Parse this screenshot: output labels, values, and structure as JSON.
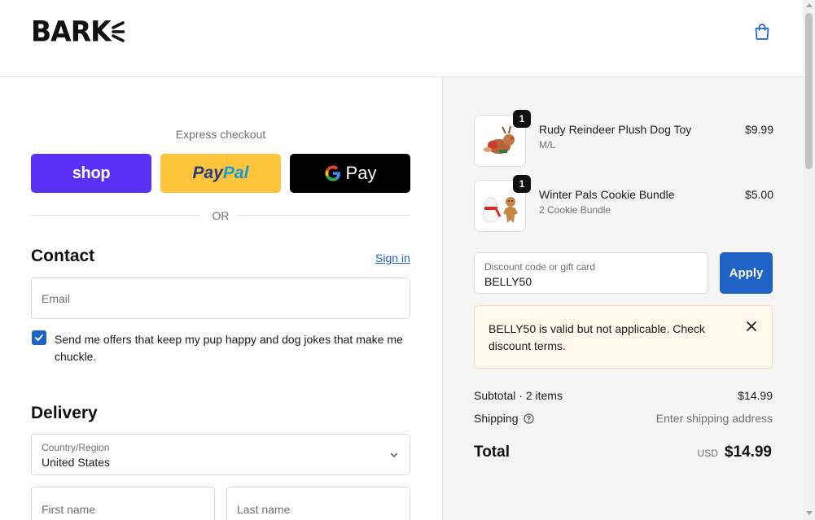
{
  "header": {
    "logo_text": "BARK",
    "cart_icon": "shopping-bag-icon"
  },
  "express": {
    "label": "Express checkout",
    "shop_label": "shop",
    "paypal_label_a": "Pay",
    "paypal_label_b": "Pal",
    "gpay_g": "G",
    "gpay_label": "Pay",
    "or_label": "OR"
  },
  "contact": {
    "title": "Contact",
    "signin_label": "Sign in",
    "email_placeholder": "Email",
    "offers_label": "Send me offers that keep my pup happy and dog jokes that make me chuckle.",
    "offers_checked": true
  },
  "delivery": {
    "title": "Delivery",
    "country_label": "Country/Region",
    "country_value": "United States",
    "first_name_placeholder": "First name",
    "last_name_placeholder": "Last name"
  },
  "cart": {
    "items": [
      {
        "qty": "1",
        "name": "Rudy Reindeer Plush Dog Toy",
        "variant": "M/L",
        "price": "$9.99"
      },
      {
        "qty": "1",
        "name": "Winter Pals Cookie Bundle",
        "variant": "2 Cookie Bundle",
        "price": "$5.00"
      }
    ],
    "discount_label": "Discount code or gift card",
    "discount_value": "BELLY50",
    "apply_label": "Apply",
    "notice": "BELLY50 is valid but not applicable. Check discount terms.",
    "subtotal_label": "Subtotal · 2 items",
    "subtotal_value": "$14.99",
    "shipping_label": "Shipping",
    "shipping_value": "Enter shipping address",
    "total_label": "Total",
    "currency": "USD",
    "total_value": "$14.99"
  },
  "colors": {
    "accent": "#1f63c6",
    "shop_pay": "#5a31f4",
    "paypal": "#ffc439",
    "notice_bg": "#fff8ec"
  }
}
